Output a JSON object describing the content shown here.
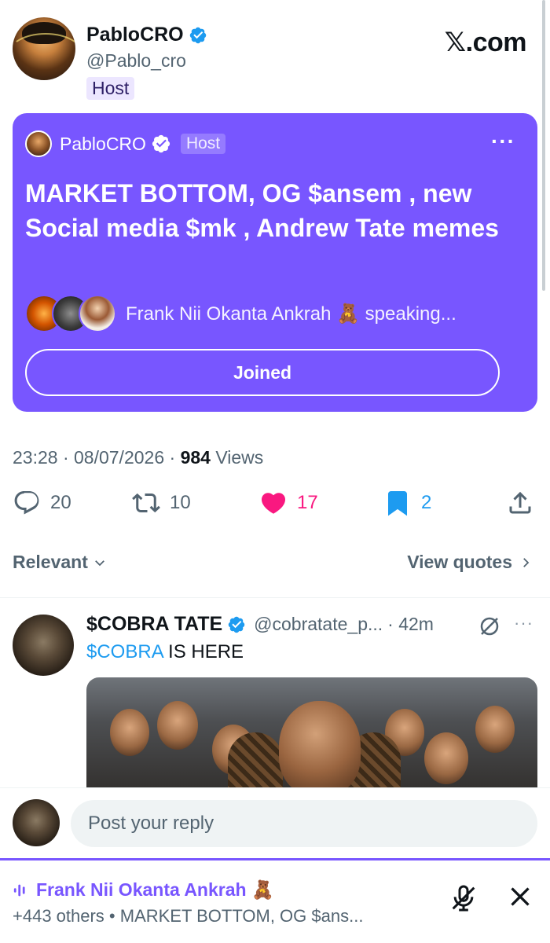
{
  "colors": {
    "accent": "#7856ff",
    "like": "#f91880",
    "bookmark": "#1d9bf0",
    "link": "#1d9bf0",
    "muted": "#536471"
  },
  "header": {
    "author_name": "PabloCRO",
    "author_handle": "@Pablo_cro",
    "host_label": "Host",
    "site_logo": "𝕏.com"
  },
  "space_card": {
    "host_name": "PabloCRO",
    "host_label": "Host",
    "more_icon": "more-icon",
    "title": "MARKET BOTTOM, OG $ansem , new Social media $mk , Andrew Tate memes",
    "speaking_text": "Frank Nii Okanta Ankrah 🧸 speaking...",
    "joined_label": "Joined"
  },
  "meta": {
    "time_date": "23:28 · 08/07/2026 · ",
    "views_count": "984",
    "views_label": " Views"
  },
  "actions": {
    "replies": "20",
    "reposts": "10",
    "likes": "17",
    "bookmarks": "2"
  },
  "sort": {
    "relevant_label": "Relevant",
    "view_quotes_label": "View quotes"
  },
  "reply": {
    "name": "$COBRA TATE",
    "handle": "@cobratate_p...",
    "time": "· 42m",
    "text_cashtag": "$COBRA",
    "text_rest": " IS HERE"
  },
  "reply_bar": {
    "placeholder": "Post your reply"
  },
  "space_dock": {
    "speaker_name": "Frank Nii Okanta Ankrah 🧸",
    "subtitle": "+443 others • MARKET BOTTOM, OG $ans..."
  }
}
